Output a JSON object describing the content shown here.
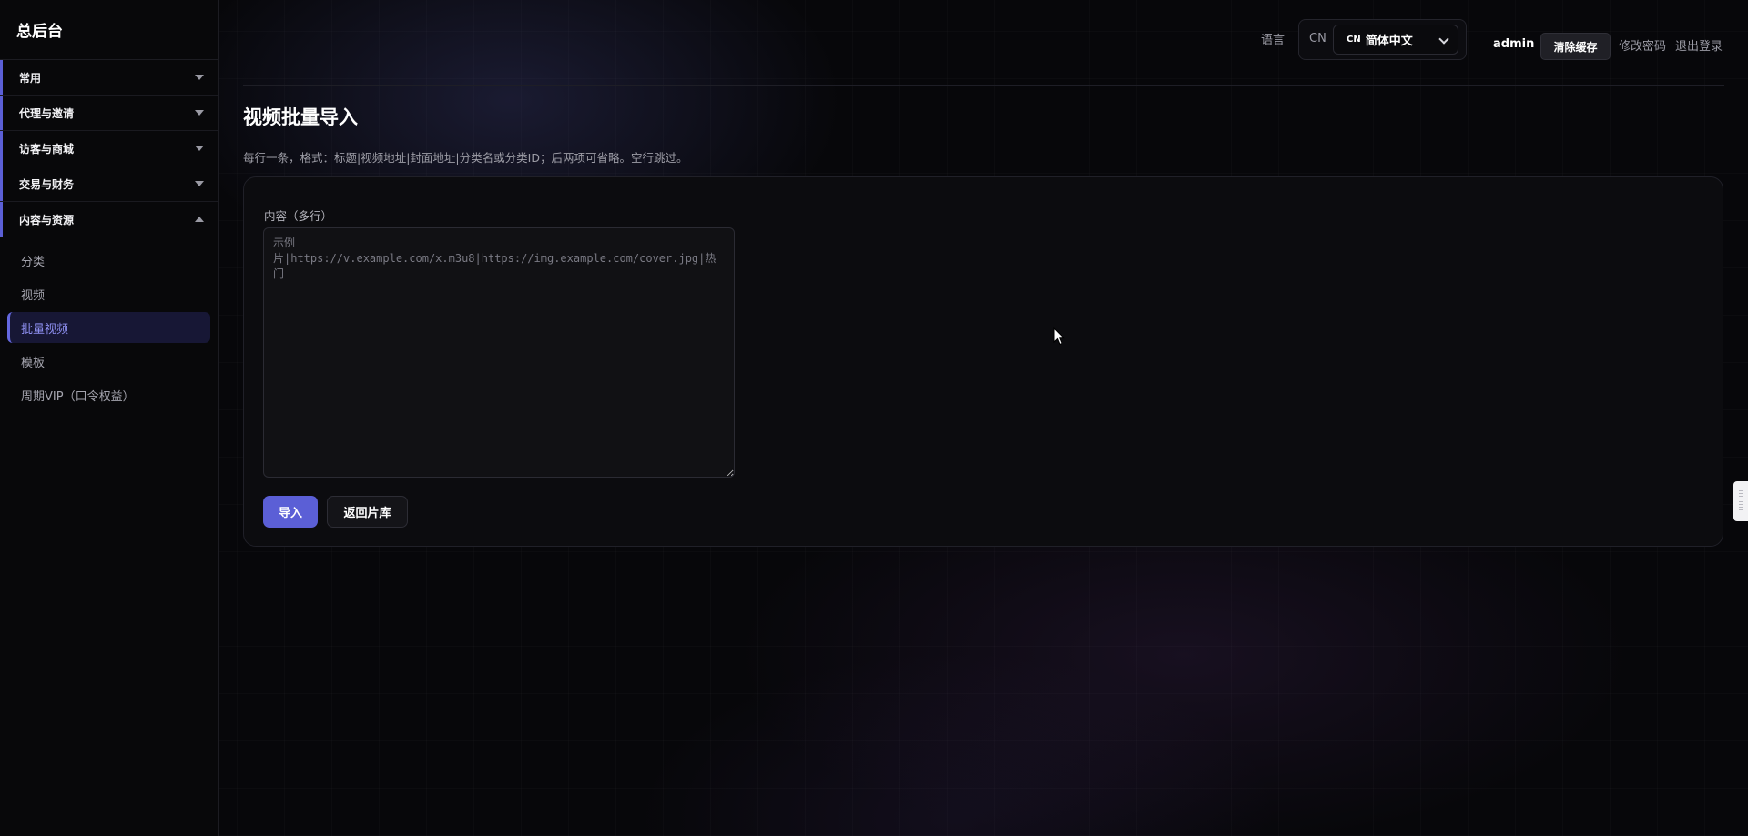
{
  "sidebar": {
    "brand": "总后台",
    "groups": [
      {
        "label": "常用",
        "expanded": false
      },
      {
        "label": "代理与邀请",
        "expanded": false
      },
      {
        "label": "访客与商城",
        "expanded": false
      },
      {
        "label": "交易与财务",
        "expanded": false
      },
      {
        "label": "内容与资源",
        "expanded": true
      }
    ],
    "sub_items": [
      {
        "label": "分类",
        "active": false
      },
      {
        "label": "视频",
        "active": false
      },
      {
        "label": "批量视频",
        "active": true
      },
      {
        "label": "模板",
        "active": false
      },
      {
        "label": "周期VIP（口令权益）",
        "active": false
      }
    ]
  },
  "header": {
    "language_label": "语言",
    "language_prefix": "CN",
    "language_code": "CN",
    "language_value": "简体中文",
    "username": "admin",
    "clear_cache": "清除缓存",
    "change_password": "修改密码",
    "logout": "退出登录"
  },
  "main": {
    "title": "视频批量导入",
    "hint": "每行一条，格式：标题|视频地址|封面地址|分类名或分类ID；后两项可省略。空行跳过。",
    "content_label": "内容（多行）",
    "content_value": "",
    "content_placeholder": "示例片|https://v.example.com/x.m3u8|https://img.example.com/cover.jpg|热门",
    "import_button": "导入",
    "back_button": "返回片库"
  },
  "colors": {
    "accent": "#5b5fd6",
    "active_text": "#8e8ff0",
    "background": "#07070a"
  },
  "icons": {
    "group_toggle": "chevron-down-icon",
    "group_toggle_expanded": "chevron-up-icon",
    "select_arrow": "chevron-down-icon",
    "cursor": "mouse-pointer-icon"
  }
}
